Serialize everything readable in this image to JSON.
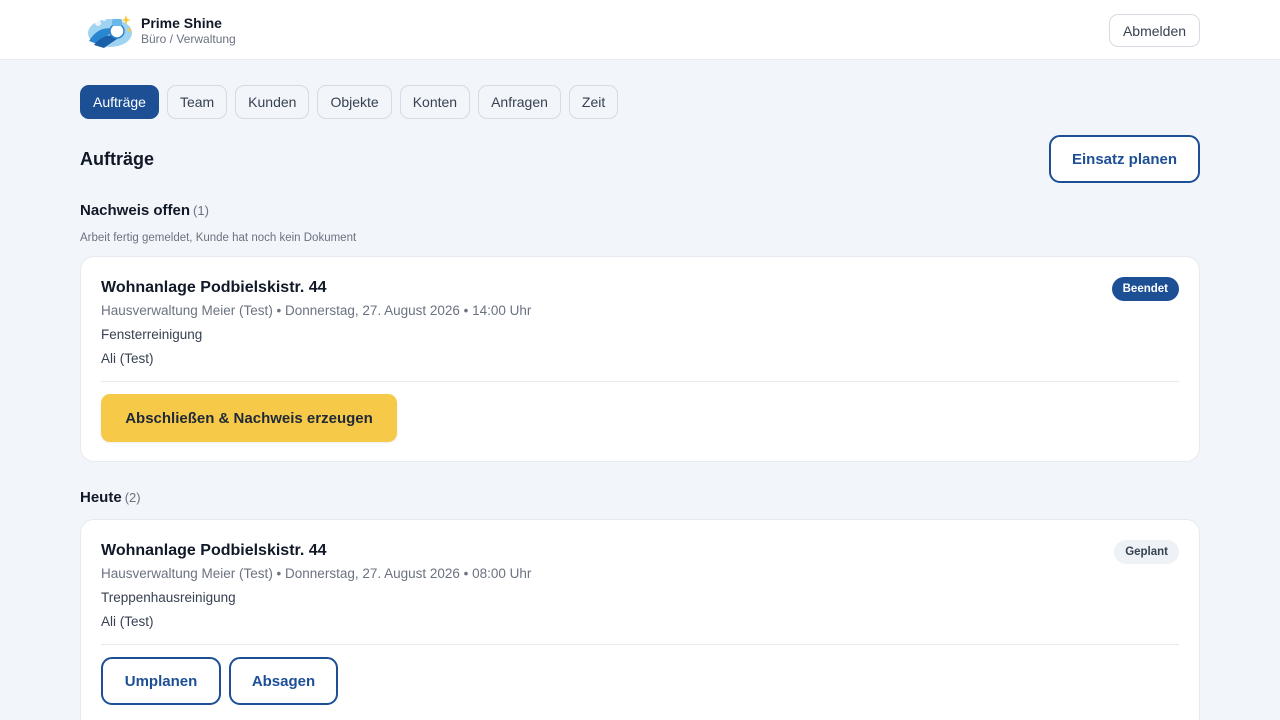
{
  "header": {
    "brand_name": "Prime Shine",
    "brand_sub": "Büro / Verwaltung",
    "logout_label": "Abmelden"
  },
  "tabs": [
    {
      "label": "Aufträge",
      "active": true
    },
    {
      "label": "Team"
    },
    {
      "label": "Kunden"
    },
    {
      "label": "Objekte"
    },
    {
      "label": "Konten"
    },
    {
      "label": "Anfragen"
    },
    {
      "label": "Zeit"
    }
  ],
  "page": {
    "title": "Aufträge",
    "plan_button": "Einsatz planen"
  },
  "sections": {
    "open": {
      "title": "Nachweis offen",
      "count": "(1)",
      "subtitle": "Arbeit fertig gemeldet, Kunde hat noch kein Dokument",
      "card": {
        "title": "Wohnanlage Podbielskistr. 44",
        "meta": "Hausverwaltung Meier (Test) • Donnerstag, 27. August 2026 • 14:00 Uhr",
        "service": "Fensterreinigung",
        "person": "Ali (Test)",
        "badge": "Beendet",
        "action": "Abschließen & Nachweis erzeugen"
      }
    },
    "today": {
      "title": "Heute",
      "count": "(2)",
      "card": {
        "title": "Wohnanlage Podbielskistr. 44",
        "meta": "Hausverwaltung Meier (Test) • Donnerstag, 27. August 2026 • 08:00 Uhr",
        "service": "Treppenhausreinigung",
        "person": "Ali (Test)",
        "badge": "Geplant",
        "reschedule": "Umplanen",
        "cancel": "Absagen"
      }
    }
  },
  "colors": {
    "primary": "#1d4f95",
    "accent_yellow": "#f7c948",
    "background": "#f2f5f9"
  }
}
